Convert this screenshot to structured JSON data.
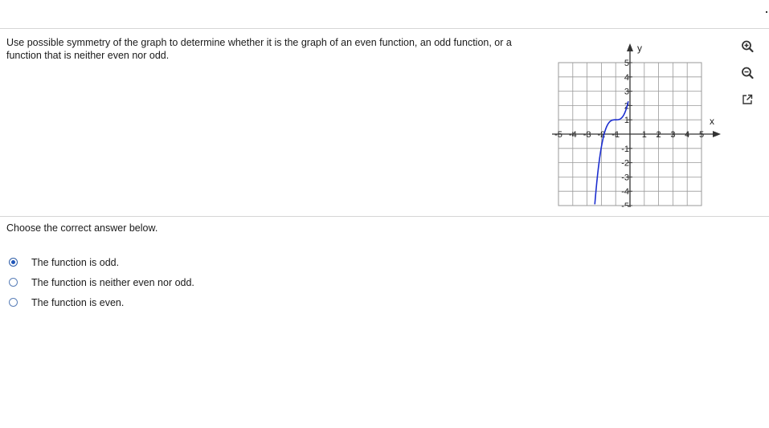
{
  "question": {
    "text": "Use possible symmetry of the graph to determine whether it is the graph of an even function, an odd function, or a function that is neither even nor odd."
  },
  "graph": {
    "x_axis_label": "x",
    "y_axis_label": "y",
    "x_tick_labels": [
      "-5",
      "-4",
      "-3",
      "-2",
      "-1",
      "1",
      "2",
      "3",
      "4",
      "5"
    ],
    "y_tick_labels": [
      "5",
      "4",
      "3",
      "2",
      "1",
      "-1",
      "-2",
      "-3",
      "-4",
      "-5"
    ],
    "curve_color": "#1d2fd0",
    "x_range": [
      -5,
      5
    ],
    "y_range": [
      -5,
      5
    ]
  },
  "tools": [
    {
      "name": "zoom-in-icon"
    },
    {
      "name": "zoom-out-icon"
    },
    {
      "name": "popout-icon"
    }
  ],
  "prompt": "Choose the correct answer below.",
  "options": [
    {
      "label": "The function is odd.",
      "selected": true
    },
    {
      "label": "The function is neither even nor odd.",
      "selected": false
    },
    {
      "label": "The function is even.",
      "selected": false
    }
  ],
  "colors": {
    "accent": "#1f55b8",
    "divider": "#d6d6d6",
    "grid": "#9a9a9a"
  }
}
